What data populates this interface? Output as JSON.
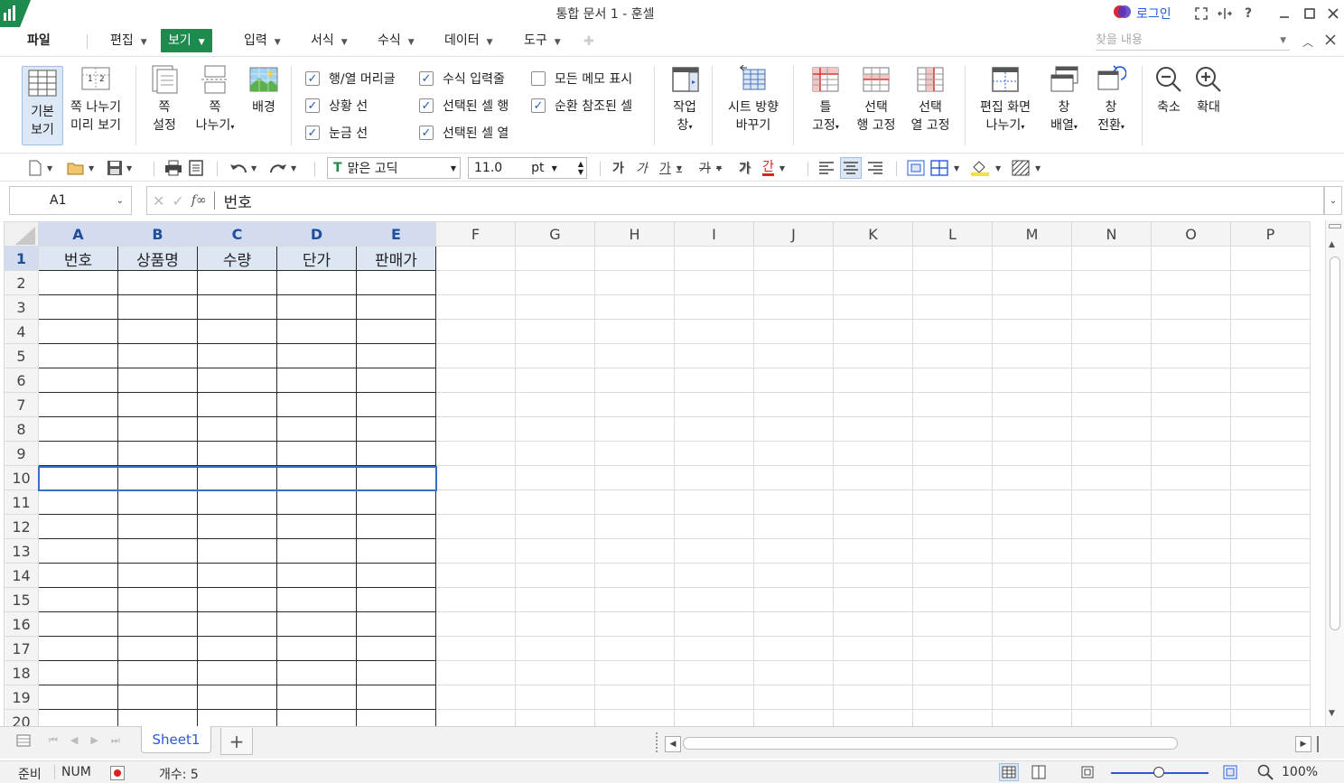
{
  "title_bar": {
    "title": "통합 문서 1 - 훈셀",
    "login_label": "로그인"
  },
  "menu": {
    "file": "파일",
    "items": [
      "편집",
      "보기",
      "입력",
      "서식",
      "수식",
      "데이터",
      "도구"
    ],
    "active": "보기",
    "search_placeholder": "찾을 내용"
  },
  "ribbon": {
    "normal_view": [
      "기본",
      "보기"
    ],
    "page_break_preview": [
      "쪽 나누기",
      "미리 보기"
    ],
    "page_setup": [
      "쪽",
      "설정"
    ],
    "page_break": [
      "쪽",
      "나누기"
    ],
    "background": "배경",
    "checkboxes": [
      {
        "label": "행/열 머리글",
        "checked": true
      },
      {
        "label": "상황 선",
        "checked": true
      },
      {
        "label": "눈금 선",
        "checked": true
      },
      {
        "label": "수식 입력줄",
        "checked": true
      },
      {
        "label": "선택된 셀 행",
        "checked": true
      },
      {
        "label": "선택된 셀 열",
        "checked": true
      },
      {
        "label": "모든 메모 표시",
        "checked": false
      },
      {
        "label": "순환 참조된 셀",
        "checked": true
      }
    ],
    "task_pane": [
      "작업",
      "창"
    ],
    "sheet_direction": [
      "시트 방향",
      "바꾸기"
    ],
    "freeze": [
      "틀",
      "고정"
    ],
    "freeze_row": [
      "선택",
      "행 고정"
    ],
    "freeze_col": [
      "선택",
      "열 고정"
    ],
    "split": [
      "편집 화면",
      "나누기"
    ],
    "arrange": [
      "창",
      "배열"
    ],
    "switch": [
      "창",
      "전환"
    ],
    "zoom_out": "축소",
    "zoom_in": "확대"
  },
  "toolbar": {
    "font_name": "맑은 고딕",
    "font_size": "11.0",
    "font_unit": "pt",
    "bold_glyph": "가",
    "italic_glyph": "가",
    "underline_glyph": "가",
    "strike_glyph": "가",
    "shadow_glyph": "가",
    "color_glyph": "간"
  },
  "formula_bar": {
    "cell_ref": "A1",
    "formula": "번호"
  },
  "sheet": {
    "columns": [
      "A",
      "B",
      "C",
      "D",
      "E",
      "F",
      "G",
      "H",
      "I",
      "J",
      "K",
      "L",
      "M",
      "N",
      "O",
      "P"
    ],
    "rows": [
      "1",
      "2",
      "3",
      "4",
      "5",
      "6",
      "7",
      "8",
      "9",
      "10",
      "11",
      "12",
      "13",
      "14",
      "15",
      "16",
      "17",
      "18",
      "19",
      "20"
    ],
    "header_row": [
      "번호",
      "상품명",
      "수량",
      "단가",
      "판매가"
    ],
    "tab": "Sheet1"
  },
  "status": {
    "ready": "준비",
    "num": "NUM",
    "count": "개수: 5",
    "zoom": "100%"
  },
  "colors": {
    "accent": "#1d8a4e",
    "selection": "#3a6fc8",
    "header_highlight": "#d3dcef"
  }
}
